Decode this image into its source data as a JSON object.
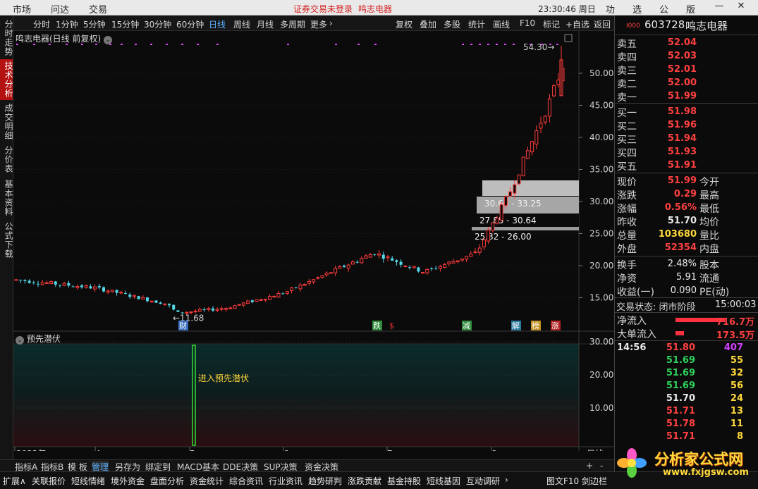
{
  "menubar": {
    "items": [
      "市场",
      "问达",
      "交易"
    ],
    "warning": "证券交易未登录",
    "stock_name": "鸣志电器",
    "clock": "23:30:46 周日",
    "right": [
      "功能",
      "选项",
      "公式",
      "版面"
    ]
  },
  "lefttabs": [
    "分时走势",
    "技术分析",
    "成交明细",
    "分价表",
    "基本资料",
    "公式下载"
  ],
  "periods": [
    "分时",
    "1分钟",
    "5分钟",
    "15分钟",
    "30分钟",
    "60分钟",
    "日线",
    "周线",
    "月线",
    "多周期",
    "更多"
  ],
  "tools": [
    "复权",
    "叠加",
    "多股",
    "统计",
    "画线",
    "F10",
    "标记",
    "+自选",
    "返回"
  ],
  "chart_title": "鸣志电器(日线 前复权)",
  "indicator_title": "预先潜伏",
  "indicator_label": "进入预先潜伏",
  "chart_data": {
    "type": "candlestick",
    "x": [
      "2022-03-01",
      "2022-03-31",
      "2022-04-29",
      "2022-05-31",
      "2022-06-30",
      "2022-07-15",
      "2022-07-28",
      "2022-08-10",
      "2022-08-22",
      "2022-08-26"
    ],
    "close": [
      17.8,
      16.5,
      14.0,
      12.6,
      14.2,
      15.8,
      22.0,
      19.0,
      31.0,
      54.3
    ],
    "annotations": [
      "11.68",
      "54.30"
    ],
    "ylim": [
      10,
      55
    ]
  },
  "yaxis_main": [
    "50.00",
    "45.00",
    "40.00",
    "35.00",
    "30.00",
    "25.00",
    "20.00",
    "15.00"
  ],
  "yaxis_sub": [
    "30.00",
    "20.00",
    "10.00"
  ],
  "xaxis": [
    "2022年",
    "4",
    "5",
    "6",
    "7",
    "8"
  ],
  "x_right": "日线",
  "price_bands": [
    "30.64 - 33.25",
    "27.85 - 30.64",
    "25.32 - 26.00"
  ],
  "markers": [
    "财",
    "跌",
    "$",
    "减",
    "解",
    "榜",
    "涨"
  ],
  "bottom1": [
    "指标A",
    "指标B",
    "模 板",
    "管理",
    "另存为",
    "绑定到",
    "MACD基本",
    "DDE决策",
    "SUP决策",
    "资金决策"
  ],
  "bottom2": [
    "扩展∧",
    "关联报价",
    "短线情绪",
    "境外资金",
    "盘面分析",
    "资金统计",
    "综合资讯",
    "行业资讯",
    "趋势研判",
    "涨跌贡献",
    "基金持股",
    "短线基因",
    "互动调研"
  ],
  "bottom2_right": "图文F10 剑边栏",
  "quote": {
    "code": "603728",
    "name": "鸣志电器",
    "prefix": "I000",
    "asks": [
      {
        "label": "卖五",
        "price": "52.04"
      },
      {
        "label": "卖四",
        "price": "52.03"
      },
      {
        "label": "卖三",
        "price": "52.01"
      },
      {
        "label": "卖二",
        "price": "52.00"
      },
      {
        "label": "卖一",
        "price": "51.99"
      }
    ],
    "bids": [
      {
        "label": "买一",
        "price": "51.98"
      },
      {
        "label": "买二",
        "price": "51.96"
      },
      {
        "label": "买三",
        "price": "51.94"
      },
      {
        "label": "买四",
        "price": "51.93"
      },
      {
        "label": "买五",
        "price": "51.91"
      }
    ],
    "stats": [
      {
        "l": "现价",
        "v": "51.99",
        "c": "red",
        "r": "今开"
      },
      {
        "l": "涨跌",
        "v": "0.29",
        "c": "red",
        "r": "最高"
      },
      {
        "l": "涨幅",
        "v": "0.56%",
        "c": "red",
        "r": "最低"
      },
      {
        "l": "昨收",
        "v": "51.70",
        "c": "wht",
        "r": "均价"
      },
      {
        "l": "总量",
        "v": "103680",
        "c": "yel",
        "r": "量比"
      },
      {
        "l": "外盘",
        "v": "52354",
        "c": "red",
        "r": "内盘"
      }
    ],
    "stats2": [
      {
        "l": "换手",
        "v": "2.48%",
        "r": "股本"
      },
      {
        "l": "净资",
        "v": "5.91",
        "r": "流通"
      },
      {
        "l": "收益(一)",
        "v": "0.090",
        "r": "PE(动)"
      }
    ],
    "status": "交易状态: 闭市阶段",
    "status_time": "15:00:03",
    "flows": [
      {
        "l": "净流入",
        "v": "716.7万",
        "w": 70
      },
      {
        "l": "大单流入",
        "v": "173.5万",
        "w": 12
      }
    ],
    "ticks": [
      {
        "t": "14:56",
        "p": "51.80",
        "pc": "red",
        "v": "407",
        "vc": "mag"
      },
      {
        "t": "",
        "p": "51.69",
        "pc": "grn",
        "v": "55",
        "vc": "yel"
      },
      {
        "t": "",
        "p": "51.69",
        "pc": "grn",
        "v": "32",
        "vc": "yel"
      },
      {
        "t": "",
        "p": "51.69",
        "pc": "grn",
        "v": "56",
        "vc": "yel"
      },
      {
        "t": "",
        "p": "51.70",
        "pc": "wht",
        "v": "24",
        "vc": "yel"
      },
      {
        "t": "",
        "p": "51.71",
        "pc": "red",
        "v": "13",
        "vc": "yel"
      },
      {
        "t": "",
        "p": "51.78",
        "pc": "red",
        "v": "11",
        "vc": "yel"
      },
      {
        "t": "",
        "p": "51.71",
        "pc": "red",
        "v": "8",
        "vc": "yel"
      }
    ]
  },
  "logo": {
    "text": "分析家公式网",
    "url": "www.fxjgsw.com"
  },
  "colors": {
    "up": "#ff3b3b",
    "down": "#54d8e8",
    "bg": "#0b0b0b",
    "accent": "#b41212"
  }
}
